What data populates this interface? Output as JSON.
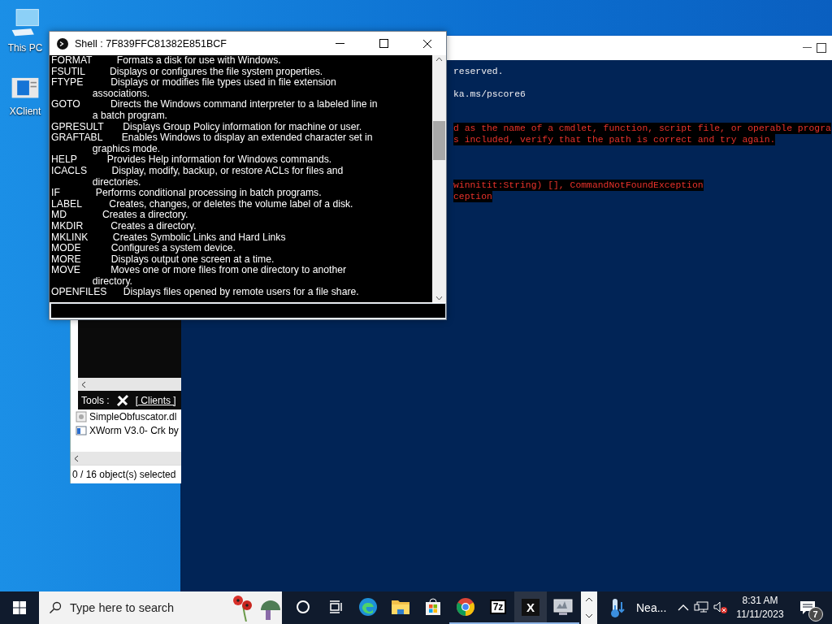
{
  "desktop_icons": [
    {
      "label": "This PC",
      "kind": "computer"
    },
    {
      "label": "XClient",
      "kind": "document"
    }
  ],
  "powershell": {
    "blocks": [
      {
        "kind": "output",
        "lines": [
          "reserved."
        ]
      },
      {
        "kind": "output",
        "lines": [
          "ka.ms/pscore6"
        ]
      },
      {
        "kind": "error",
        "lines": [
          "d as the name of a cmdlet, function, script file, or operable progra",
          "s included, verify that the path is correct and try again."
        ]
      },
      {
        "kind": "error",
        "lines": [
          "winnitit:String) [], CommandNotFoundException",
          "ception"
        ]
      }
    ]
  },
  "shell_window": {
    "title": "Shell : 7F839FFC81382E851BCF",
    "lines": [
      "FORMAT         Formats a disk for use with Windows.",
      "FSUTIL         Displays or configures the file system properties.",
      "FTYPE          Displays or modifies file types used in file extension",
      "               associations.",
      "GOTO           Directs the Windows command interpreter to a labeled line in",
      "               a batch program.",
      "GPRESULT       Displays Group Policy information for machine or user.",
      "GRAFTABL       Enables Windows to display an extended character set in",
      "               graphics mode.",
      "HELP           Provides Help information for Windows commands.",
      "ICACLS         Display, modify, backup, or restore ACLs for files and",
      "               directories.",
      "IF             Performs conditional processing in batch programs.",
      "LABEL          Creates, changes, or deletes the volume label of a disk.",
      "MD             Creates a directory.",
      "MKDIR          Creates a directory.",
      "MKLINK         Creates Symbolic Links and Hard Links",
      "MODE           Configures a system device.",
      "MORE           Displays output one screen at a time.",
      "MOVE           Moves one or more files from one directory to another",
      "               directory.",
      "OPENFILES      Displays files opened by remote users for a file share."
    ]
  },
  "explorer": {
    "tools_label": "Tools :",
    "clients_link": "[ Clients ]",
    "files": [
      {
        "name": "SimpleObfuscator.dl",
        "kind": "dll"
      },
      {
        "name": "XWorm V3.0- Crk by",
        "kind": "app"
      }
    ],
    "status": "0 / 16 object(s) selected"
  },
  "taskbar": {
    "search": {
      "placeholder": "Type here to search"
    },
    "apps": [
      {
        "kind": "cortana",
        "running": false,
        "active": false
      },
      {
        "kind": "taskview",
        "running": false,
        "active": false
      },
      {
        "kind": "edge",
        "running": false,
        "active": false
      },
      {
        "kind": "explorer",
        "running": false,
        "active": false
      },
      {
        "kind": "store",
        "running": false,
        "active": false
      },
      {
        "kind": "chrome",
        "running": true,
        "active": false
      },
      {
        "kind": "sevenzip",
        "label": "7z",
        "running": true,
        "active": false
      },
      {
        "kind": "xworm",
        "label": "X",
        "running": true,
        "active": true
      },
      {
        "kind": "monitor",
        "running": true,
        "active": false
      }
    ],
    "weather": {
      "label": "Nea..."
    },
    "clock": {
      "time": "8:31 AM",
      "date": "11/11/2023"
    },
    "notifications": {
      "count": "7"
    }
  }
}
